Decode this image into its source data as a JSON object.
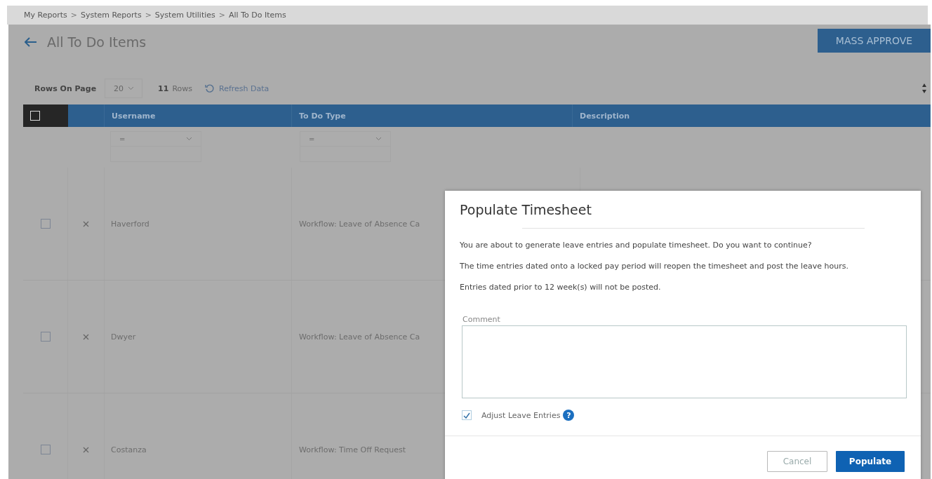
{
  "breadcrumb": [
    "My Reports",
    "System Reports",
    "System Utilities",
    "All To Do Items"
  ],
  "breadcrumb_separator": ">",
  "page_title": "All To Do Items",
  "mass_approve_button": "MASS APPROVE",
  "toolbar": {
    "rows_on_page_label": "Rows On Page",
    "rows_on_page_value": "20",
    "row_count": "11",
    "row_count_label": "Rows",
    "refresh_label": "Refresh Data"
  },
  "table": {
    "select_all_checked": false,
    "columns": [
      "Username",
      "To Do Type",
      "Description"
    ],
    "filters": [
      {
        "operator": "="
      },
      {
        "operator": "="
      }
    ],
    "rows": [
      {
        "checked": false,
        "username": "Haverford",
        "type": "Workflow: Leave of Absence Ca"
      },
      {
        "checked": false,
        "username": "Dwyer",
        "type": "Workflow: Leave of Absence Ca"
      },
      {
        "checked": false,
        "username": "Costanza",
        "type": "Workflow: Time Off Request"
      }
    ]
  },
  "dialog": {
    "title": "Populate Timesheet",
    "messages": [
      "You are about to generate leave entries and populate timesheet. Do you want to continue?",
      "The time entries dated onto a locked pay period will reopen the timesheet and post the leave hours.",
      "Entries dated prior to 12 week(s) will not be posted."
    ],
    "comment_label": "Comment",
    "adjust_leave_entries": {
      "label": "Adjust Leave Entries",
      "checked": true,
      "help": "?"
    },
    "buttons": [
      {
        "label": "Cancel",
        "kind": "secondary"
      },
      {
        "label": "Populate",
        "kind": "primary"
      }
    ]
  }
}
